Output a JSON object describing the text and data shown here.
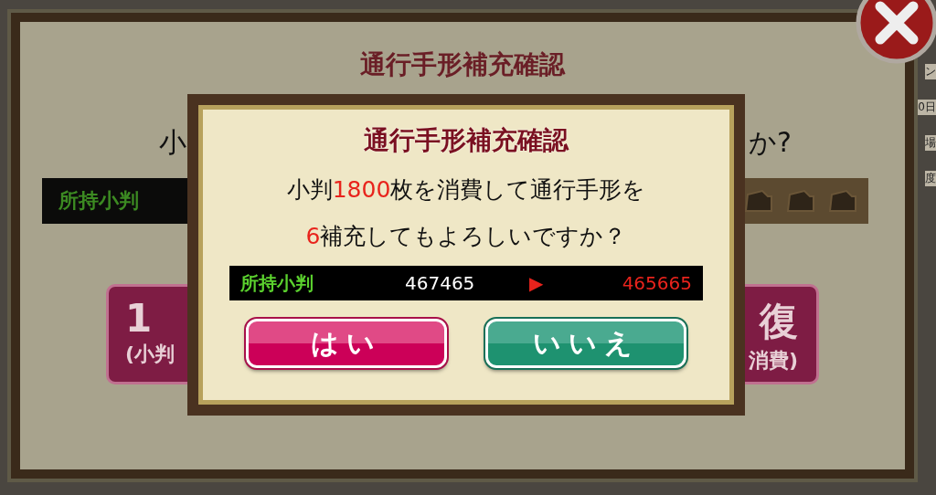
{
  "background_panel": {
    "title": "通行手形補充確認",
    "message_start": "小",
    "message_end": "か?",
    "koban_label": "所持小判",
    "left_button": {
      "line_1": "1",
      "line_2": "(小判"
    },
    "right_button": {
      "line_1": "復",
      "line_2": "消費)"
    }
  },
  "side_texts": [
    "ン",
    "0日",
    "場",
    "度"
  ],
  "dialog": {
    "title": "通行手形補充確認",
    "message_lines": [
      [
        {
          "text": "小判",
          "highlight": false
        },
        {
          "text": "1800",
          "highlight": true
        },
        {
          "text": "枚を消費して通行手形を",
          "highlight": false
        }
      ],
      [
        {
          "text": "6",
          "highlight": true
        },
        {
          "text": "補充してもよろしいですか？",
          "highlight": false
        }
      ]
    ],
    "balance": {
      "label": "所持小判",
      "current": "467465",
      "arrow": "▶",
      "after": "465665"
    },
    "buttons": [
      {
        "label": "はい",
        "kind": "confirm"
      },
      {
        "label": "いいえ",
        "kind": "cancel"
      }
    ]
  }
}
